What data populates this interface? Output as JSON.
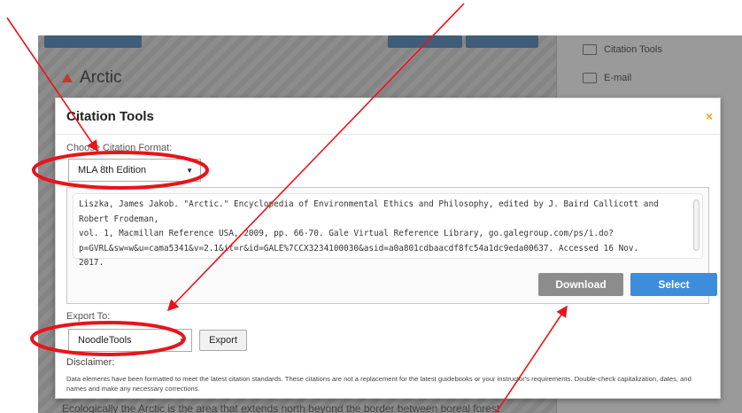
{
  "background": {
    "title": "Arctic",
    "sidebar": {
      "items": [
        {
          "label": "Citation Tools",
          "icon": "citation-icon"
        },
        {
          "label": "E-mail",
          "icon": "email-icon"
        }
      ]
    },
    "body_text": "Ecologically the Arctic is the area that extends north beyond the border between boreal forest"
  },
  "modal": {
    "title": "Citation Tools",
    "close_icon": "×",
    "format_label": "Choose Citation Format:",
    "format_value": "MLA 8th Edition",
    "citation_lines": [
      "Liszka, James Jakob. \"Arctic.\" Encyclopedia of Environmental Ethics and Philosophy, edited by J. Baird Callicott and Robert Frodeman,",
      "vol. 1, Macmillan Reference USA, 2009, pp. 66-70. Gale Virtual Reference Library, go.galegroup.com/ps/i.do?",
      "p=GVRL&sw=w&u=cama5341&v=2.1&it=r&id=GALE%7CCX3234100030&asid=a0a801cdbaacdf8fc54a1dc9eda00637. Accessed 16 Nov.",
      "2017."
    ],
    "download_label": "Download",
    "select_label": "Select",
    "export_label": "Export To:",
    "export_value": "NoodleTools",
    "export_button": "Export",
    "disclaimer_title": "Disclaimer:",
    "disclaimer_text": "Data elements have been formatted to meet the latest citation standards. These citations are not a replacement for the latest guidebooks or your instructor's requirements. Double-check capitalization, dates, and names and make any necessary corrections."
  },
  "colors": {
    "annotation_red": "#e8141b",
    "select_blue": "#3d8ddb",
    "download_gray": "#8c8c8c",
    "close_orange": "#f5a623"
  }
}
